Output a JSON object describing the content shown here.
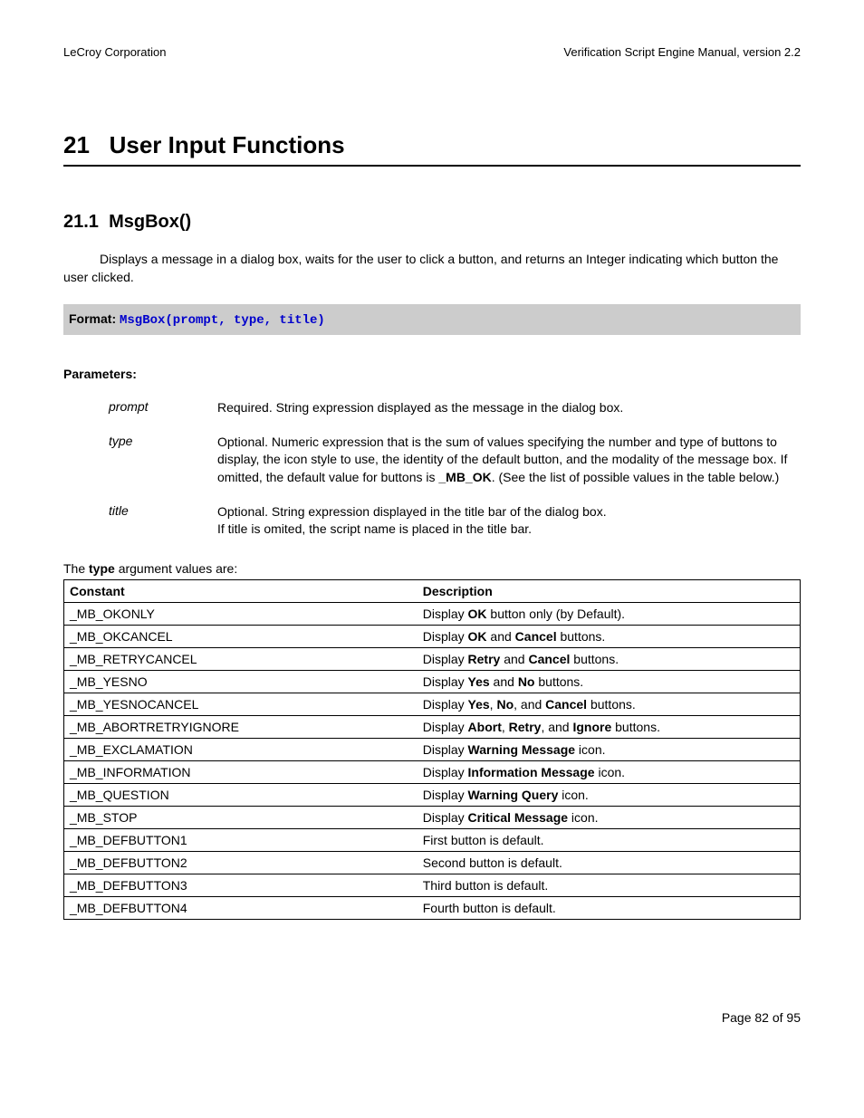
{
  "header": {
    "left": "LeCroy Corporation",
    "right": "Verification Script Engine Manual, version 2.2"
  },
  "chapter": {
    "number": "21",
    "title": "User Input Functions"
  },
  "section": {
    "number": "21.1",
    "title": "MsgBox()"
  },
  "intro": "Displays a message in a dialog box, waits for the user to click a button, and returns an Integer indicating which button the user clicked.",
  "format": {
    "label": "Format: ",
    "code": "MsgBox(prompt, type, title)"
  },
  "params_label": "Parameters:",
  "params": [
    {
      "name": "prompt",
      "desc_html": "Required. String expression displayed as the message in the dialog box."
    },
    {
      "name": "type",
      "desc_html": "Optional. Numeric expression that is the sum of values specifying the number and type of buttons to display, the icon style to use, the identity of the default button, and the modality of the message box. If omitted, the default value for buttons is <b>_MB_OK</b>. (See the list of possible values in the table below.)"
    },
    {
      "name": "title",
      "desc_html": "Optional. String expression displayed in the title bar of the dialog box.<br>If title is omited, the script name is placed in the title bar."
    }
  ],
  "table_intro_html": "The <b>type</b> argument values are:",
  "table": {
    "headers": [
      "Constant",
      "Description"
    ],
    "rows": [
      {
        "c": "_MB_OKONLY",
        "d": "Display <b>OK</b> button only (by Default)."
      },
      {
        "c": "_MB_OKCANCEL",
        "d": "Display <b>OK</b> and <b>Cancel</b> buttons."
      },
      {
        "c": "_MB_RETRYCANCEL",
        "d": "Display <b>Retry</b> and <b>Cancel</b> buttons."
      },
      {
        "c": "_MB_YESNO",
        "d": "Display <b>Yes</b> and <b>No</b> buttons."
      },
      {
        "c": "_MB_YESNOCANCEL",
        "d": "Display <b>Yes</b>, <b>No</b>, and <b>Cancel</b> buttons."
      },
      {
        "c": "_MB_ABORTRETRYIGNORE",
        "d": "Display <b>Abort</b>, <b>Retry</b>, and <b>Ignore</b> buttons."
      },
      {
        "c": "_MB_EXCLAMATION",
        "d": "Display <b>Warning Message</b> icon."
      },
      {
        "c": "_MB_INFORMATION",
        "d": "Display <b>Information Message</b> icon."
      },
      {
        "c": "_MB_QUESTION",
        "d": "Display <b>Warning Query</b> icon."
      },
      {
        "c": "_MB_STOP",
        "d": "Display <b>Critical Message</b> icon."
      },
      {
        "c": "_MB_DEFBUTTON1",
        "d": "First button is default."
      },
      {
        "c": "_MB_DEFBUTTON2",
        "d": "Second button is default."
      },
      {
        "c": "_MB_DEFBUTTON3",
        "d": "Third button is default."
      },
      {
        "c": "_MB_DEFBUTTON4",
        "d": "Fourth button is default."
      }
    ]
  },
  "footer": "Page 82 of 95"
}
